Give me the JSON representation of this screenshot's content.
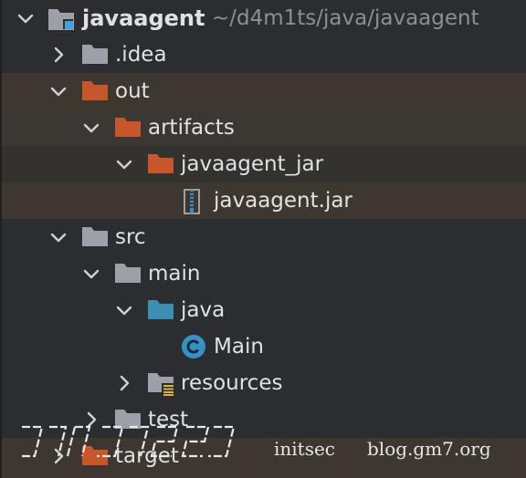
{
  "tree": {
    "root": {
      "name": "javaagent",
      "path": "~/d4m1ts/java/javaagent"
    },
    "items": [
      {
        "label": ".idea"
      },
      {
        "label": "out"
      },
      {
        "label": "artifacts"
      },
      {
        "label": "javaagent_jar"
      },
      {
        "label": "javaagent.jar"
      },
      {
        "label": "src"
      },
      {
        "label": "main"
      },
      {
        "label": "java"
      },
      {
        "label": "Main"
      },
      {
        "label": "resources"
      },
      {
        "label": "test"
      },
      {
        "label": "target"
      }
    ]
  },
  "watermark": {
    "left": "initsec",
    "right": "blog.gm7.org",
    "logo_text": "initsec"
  },
  "colors": {
    "background": "#2b2d30",
    "selected_row": "#3e3730",
    "folder_grey": "#9da0a8",
    "folder_orange": "#c7562a",
    "folder_blue": "#3c8fb4",
    "class_icon": "#3592c4"
  },
  "icons": {
    "module": "module-folder-icon",
    "folder": "folder-icon",
    "excluded_folder": "excluded-folder-icon",
    "source_folder": "source-folder-icon",
    "resources_folder": "resources-folder-icon",
    "jar": "archive-icon",
    "class": "java-class-icon"
  }
}
